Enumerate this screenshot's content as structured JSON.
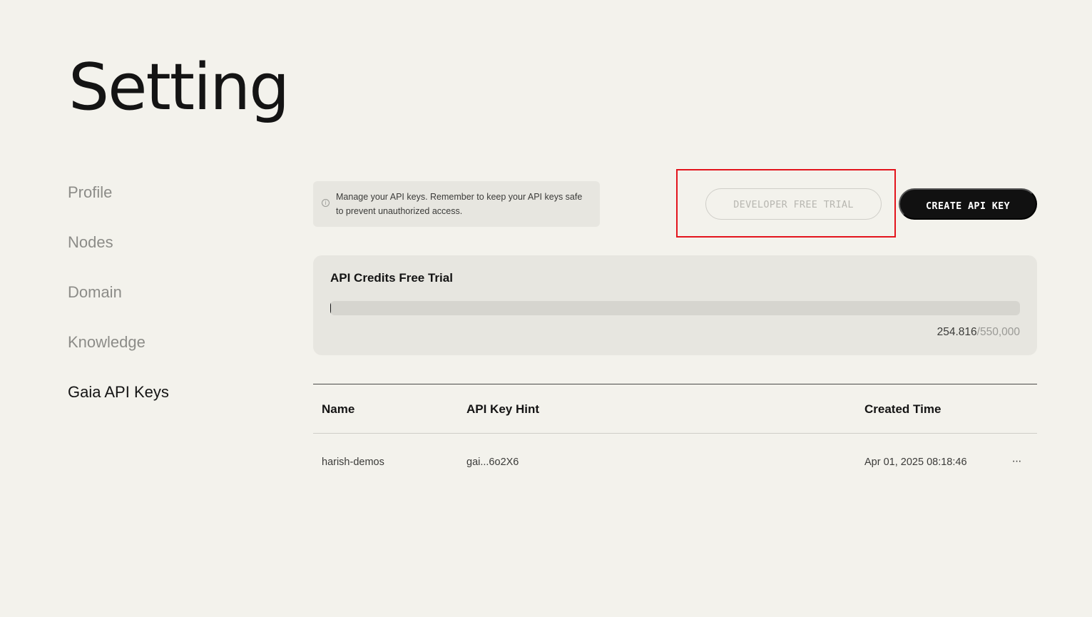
{
  "page": {
    "title": "Setting"
  },
  "sidebar": {
    "items": [
      {
        "label": "Profile"
      },
      {
        "label": "Nodes"
      },
      {
        "label": "Domain"
      },
      {
        "label": "Knowledge"
      },
      {
        "label": "Gaia API Keys"
      }
    ],
    "active": "Gaia API Keys"
  },
  "info": {
    "icon": "info-icon",
    "text": "Manage your API keys. Remember to keep your API keys safe to prevent unauthorized access."
  },
  "actions": {
    "trial_label": "DEVELOPER FREE TRIAL",
    "create_label": "CREATE API KEY"
  },
  "credits": {
    "title": "API Credits Free Trial",
    "used": "254.816",
    "total": "/550,000",
    "used_fraction": 0.00046
  },
  "table": {
    "headers": {
      "name": "Name",
      "hint": "API Key Hint",
      "created": "Created Time"
    },
    "rows": [
      {
        "name": "harish-demos",
        "hint": "gai...6o2X6",
        "created": "Apr 01, 2025 08:18:46",
        "more": "···"
      }
    ]
  },
  "colors": {
    "background": "#f3f2ec",
    "card": "#e7e6e0",
    "primary_button": "#111111",
    "highlight": "#e3141c"
  }
}
